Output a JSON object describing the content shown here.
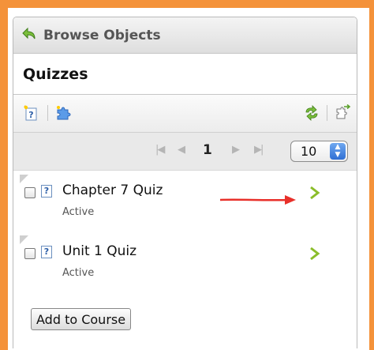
{
  "header": {
    "title": "Browse Objects",
    "icon": "back-arrow-icon"
  },
  "section": {
    "title": "Quizzes"
  },
  "toolbar": {
    "left_icons": [
      "new-quiz-icon",
      "puzzle-icon"
    ],
    "right_icons": [
      "refresh-icon",
      "export-icon"
    ]
  },
  "pager": {
    "first_symbol": "|◀",
    "prev_symbol": "◀",
    "current_page": "1",
    "next_symbol": "▶",
    "last_symbol": "▶|",
    "page_size": "10"
  },
  "items": [
    {
      "title": "Chapter 7 Quiz",
      "status": "Active"
    },
    {
      "title": "Unit 1 Quiz",
      "status": "Active"
    }
  ],
  "actions": {
    "add_to_course": "Add to Course"
  },
  "colors": {
    "frame": "#f4923a",
    "annotation_arrow": "#e8302a",
    "chevron": "#8bbd2a"
  }
}
